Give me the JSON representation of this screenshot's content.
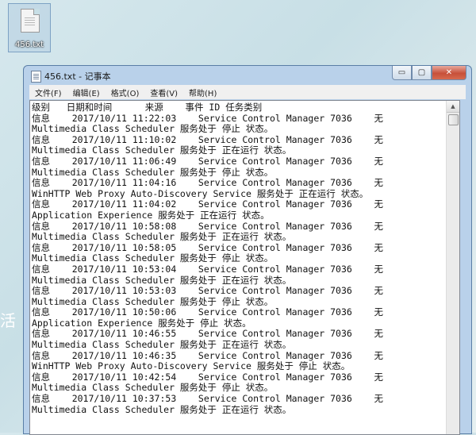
{
  "desktop": {
    "icon_label": "456.txt",
    "side_char": "活"
  },
  "window": {
    "title": "456.txt - 记事本",
    "minimize_glyph": "▭",
    "maximize_glyph": "▢",
    "close_glyph": "✕"
  },
  "menu": [
    "文件(F)",
    "编辑(E)",
    "格式(O)",
    "查看(V)",
    "帮助(H)"
  ],
  "content": {
    "lines": [
      "级别   日期和时间      来源    事件 ID 任务类别",
      "信息    2017/10/11 11:22:03    Service Control Manager 7036    无",
      "Multimedia Class Scheduler 服务处于 停止 状态。",
      "信息    2017/10/11 11:10:02    Service Control Manager 7036    无",
      "Multimedia Class Scheduler 服务处于 正在运行 状态。",
      "信息    2017/10/11 11:06:49    Service Control Manager 7036    无",
      "Multimedia Class Scheduler 服务处于 停止 状态。",
      "信息    2017/10/11 11:04:16    Service Control Manager 7036    无",
      "WinHTTP Web Proxy Auto-Discovery Service 服务处于 正在运行 状态。",
      "信息    2017/10/11 11:04:02    Service Control Manager 7036    无",
      "Application Experience 服务处于 正在运行 状态。",
      "信息    2017/10/11 10:58:08    Service Control Manager 7036    无",
      "Multimedia Class Scheduler 服务处于 正在运行 状态。",
      "信息    2017/10/11 10:58:05    Service Control Manager 7036    无",
      "Multimedia Class Scheduler 服务处于 停止 状态。",
      "信息    2017/10/11 10:53:04    Service Control Manager 7036    无",
      "Multimedia Class Scheduler 服务处于 正在运行 状态。",
      "信息    2017/10/11 10:53:03    Service Control Manager 7036    无",
      "Multimedia Class Scheduler 服务处于 停止 状态。",
      "信息    2017/10/11 10:50:06    Service Control Manager 7036    无",
      "Application Experience 服务处于 停止 状态。",
      "信息    2017/10/11 10:46:55    Service Control Manager 7036    无",
      "Multimedia Class Scheduler 服务处于 正在运行 状态。",
      "信息    2017/10/11 10:46:35    Service Control Manager 7036    无",
      "WinHTTP Web Proxy Auto-Discovery Service 服务处于 停止 状态。",
      "信息    2017/10/11 10:42:54    Service Control Manager 7036    无",
      "Multimedia Class Scheduler 服务处于 停止 状态。",
      "信息    2017/10/11 10:37:53    Service Control Manager 7036    无",
      "Multimedia Class Scheduler 服务处于 正在运行 状态。"
    ]
  }
}
